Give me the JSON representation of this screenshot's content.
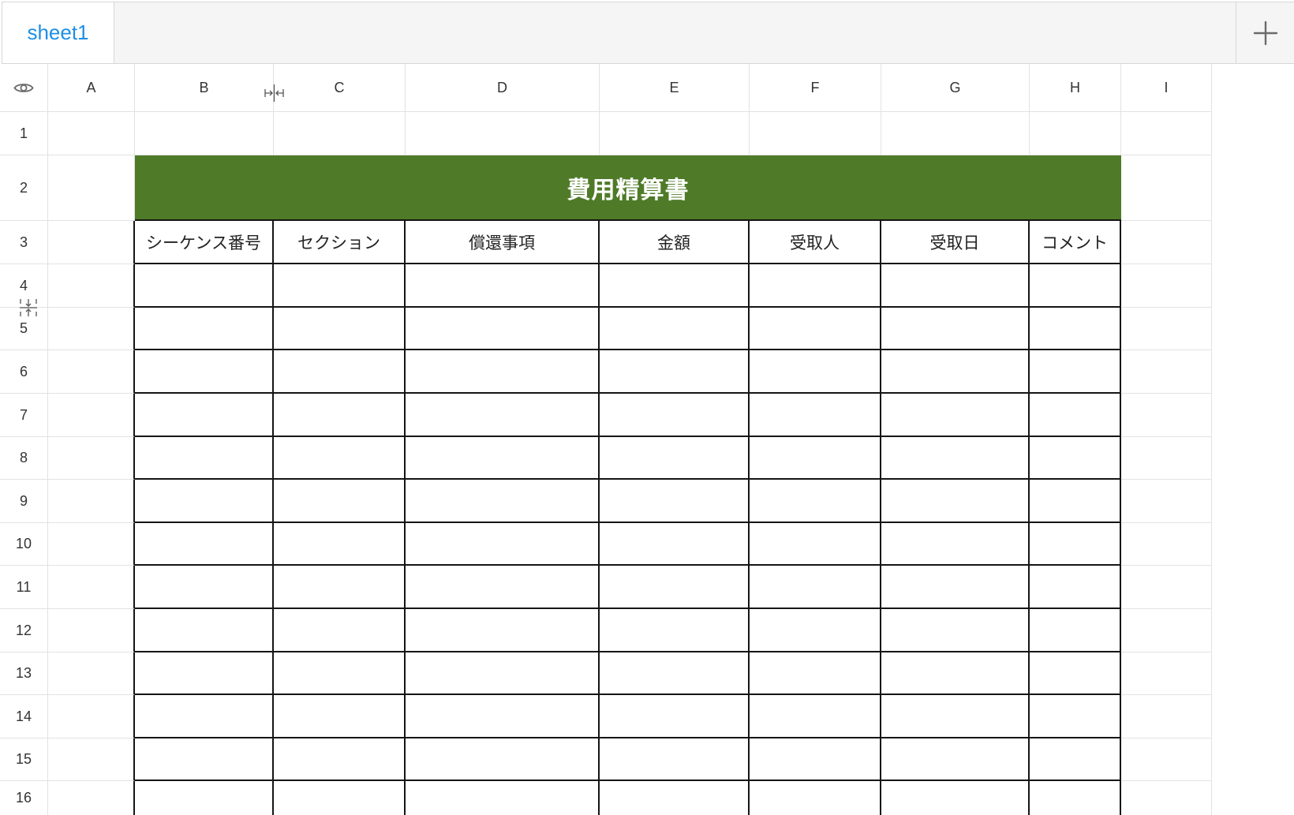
{
  "tab_bar": {
    "tabs": [
      {
        "label": "sheet1",
        "active": true
      }
    ]
  },
  "sheet": {
    "column_labels": [
      "A",
      "B",
      "C",
      "D",
      "E",
      "F",
      "G",
      "H",
      "I"
    ],
    "row_labels": [
      "1",
      "2",
      "3",
      "4",
      "5",
      "6",
      "7",
      "8",
      "9",
      "10",
      "11",
      "12",
      "13",
      "14",
      "15",
      "16"
    ]
  },
  "expense_form": {
    "title": "費用精算書",
    "headers": [
      "シーケンス番号",
      "セクション",
      "償還事項",
      "金額",
      "受取人",
      "受取日",
      "コメント"
    ]
  },
  "icons": {
    "corner": "eye-icon",
    "add_sheet": "plus-icon",
    "column_resize": "column-resize-icon",
    "row_resize": "row-resize-icon"
  },
  "colors": {
    "title_fill": "#4f7a28",
    "title_text": "#ffffff",
    "active_tab_text": "#1e8fe4",
    "tab_bar_fill": "#f5f5f5",
    "grid_line": "#e2e2e2",
    "table_border": "#151515"
  }
}
